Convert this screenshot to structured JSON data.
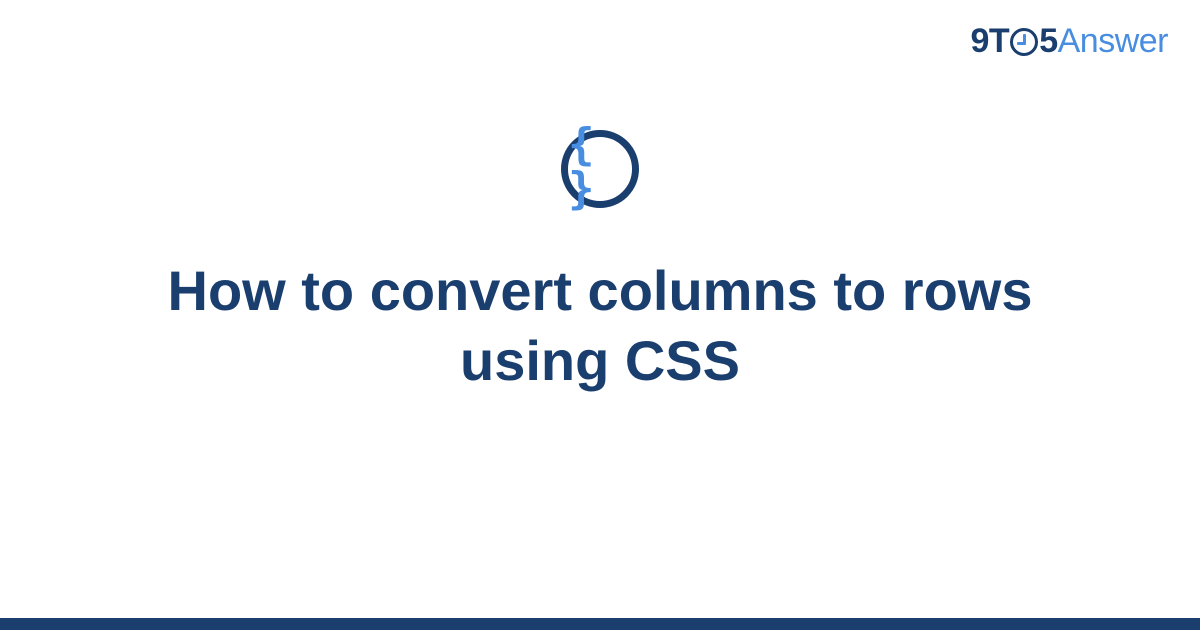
{
  "logo": {
    "nine": "9",
    "t": "T",
    "five": "5",
    "answer": "Answer"
  },
  "badge": {
    "braces": "{ }",
    "icon_name": "code-braces-icon"
  },
  "title": "How to convert columns to rows using CSS",
  "colors": {
    "dark_blue": "#1a3e6e",
    "light_blue": "#498de0",
    "background": "#ffffff"
  }
}
